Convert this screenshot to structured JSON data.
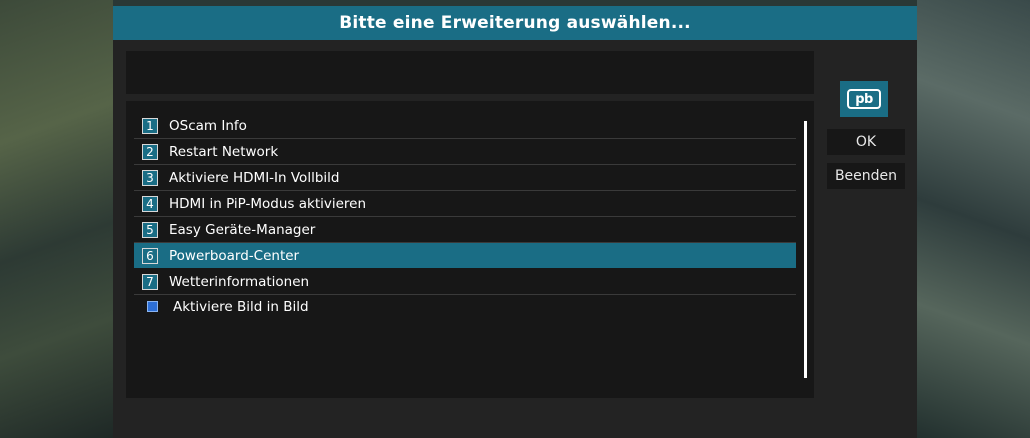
{
  "dialog": {
    "title": "Bitte eine Erweiterung auswählen...",
    "input_value": ""
  },
  "list": {
    "items": [
      {
        "number": "1",
        "label": "OScam Info"
      },
      {
        "number": "2",
        "label": "Restart Network"
      },
      {
        "number": "3",
        "label": "Aktiviere HDMI-In Vollbild"
      },
      {
        "number": "4",
        "label": "HDMI in PiP-Modus aktivieren"
      },
      {
        "number": "5",
        "label": "Easy Geräte-Manager"
      },
      {
        "number": "6",
        "label": "Powerboard-Center"
      },
      {
        "number": "7",
        "label": "Wetterinformationen"
      },
      {
        "number": "",
        "label": "Aktiviere Bild in Bild",
        "icon": "square-bullet-icon"
      }
    ],
    "selected_index": 5
  },
  "buttons": {
    "logo_text": "pb",
    "ok_label": "OK",
    "exit_label": "Beenden"
  },
  "colors": {
    "accent": "#1a6d85",
    "panel": "#171717",
    "dialog_bg": "#232323"
  }
}
